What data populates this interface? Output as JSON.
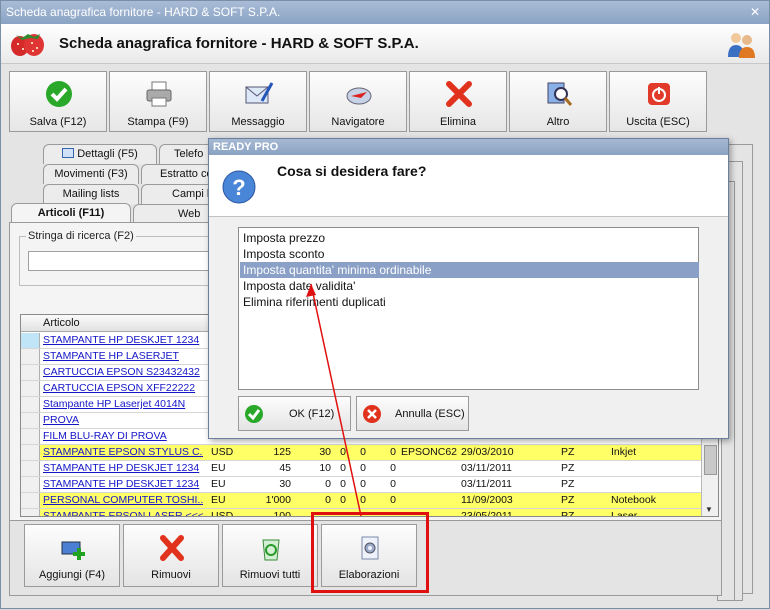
{
  "window": {
    "title": "Scheda anagrafica fornitore - HARD & SOFT S.P.A.",
    "close_glyph": "✕",
    "header_title": "Scheda anagrafica fornitore - HARD & SOFT S.P.A."
  },
  "toolbar": {
    "buttons": [
      {
        "label": "Salva (F12)",
        "icon": "check-icon"
      },
      {
        "label": "Stampa (F9)",
        "icon": "printer-icon"
      },
      {
        "label": "Messaggio",
        "icon": "mail-icon"
      },
      {
        "label": "Navigatore",
        "icon": "compass-icon"
      },
      {
        "label": "Elimina",
        "icon": "delete-icon"
      },
      {
        "label": "Altro",
        "icon": "magnifier-icon"
      },
      {
        "label": "Uscita (ESC)",
        "icon": "power-icon"
      }
    ]
  },
  "tabs": {
    "row1": [
      "Dettagli (F5)",
      "Telefo"
    ],
    "row2": [
      "Movimenti (F3)",
      "Estratto co"
    ],
    "row3": [
      "Mailing lists",
      "Campi li"
    ],
    "row4": [
      "Articoli (F11)",
      "Web"
    ]
  },
  "search": {
    "label": "Stringa di ricerca (F2)",
    "value": ""
  },
  "grid": {
    "header": "Articolo",
    "rows": [
      {
        "articolo": "STAMPANTE HP DESKJET 1234",
        "yellow": false,
        "selected": true,
        "cells": []
      },
      {
        "articolo": "STAMPANTE HP LASERJET",
        "yellow": false,
        "selected": false,
        "cells": []
      },
      {
        "articolo": "CARTUCCIA EPSON S23432432",
        "yellow": false,
        "selected": false,
        "cells": []
      },
      {
        "articolo": "CARTUCCIA EPSON XFF22222",
        "yellow": false,
        "selected": false,
        "cells": []
      },
      {
        "articolo": "Stampante HP Laserjet 4014N",
        "yellow": false,
        "selected": false,
        "cells": []
      },
      {
        "articolo": "PROVA",
        "yellow": false,
        "selected": false,
        "cells": []
      },
      {
        "articolo": "FILM BLU-RAY DI PROVA",
        "yellow": false,
        "selected": false,
        "cells": []
      },
      {
        "articolo": "STAMPANTE EPSON STYLUS C...",
        "yellow": true,
        "selected": false,
        "cells": [
          "USD",
          "125",
          "30",
          "0",
          "0",
          "0",
          "EPSONC62",
          "29/03/2010",
          "PZ",
          "Inkjet"
        ]
      },
      {
        "articolo": "STAMPANTE HP DESKJET 1234",
        "yellow": false,
        "selected": false,
        "cells": [
          "EU",
          "45",
          "10",
          "0",
          "0",
          "0",
          "",
          "03/11/2011",
          "PZ",
          ""
        ]
      },
      {
        "articolo": "STAMPANTE HP DESKJET 1234",
        "yellow": false,
        "selected": false,
        "cells": [
          "EU",
          "30",
          "0",
          "0",
          "0",
          "0",
          "",
          "03/11/2011",
          "PZ",
          ""
        ]
      },
      {
        "articolo": "PERSONAL COMPUTER TOSHI...",
        "yellow": true,
        "selected": false,
        "cells": [
          "EU",
          "1'000",
          "0",
          "0",
          "0",
          "0",
          "",
          "11/09/2003",
          "PZ",
          "Notebook"
        ]
      },
      {
        "articolo": "STAMPANTE EPSON LASER <<<",
        "yellow": true,
        "selected": false,
        "cells": [
          "USD",
          "100",
          "",
          "",
          "",
          "",
          "",
          "23/05/2011",
          "PZ",
          "Laser"
        ]
      }
    ]
  },
  "bottom_buttons": [
    {
      "label": "Aggiungi (F4)",
      "icon": "add-icon"
    },
    {
      "label": "Rimuovi",
      "icon": "remove-icon"
    },
    {
      "label": "Rimuovi tutti",
      "icon": "recycle-bin-icon"
    },
    {
      "label": "Elaborazioni",
      "icon": "gear-document-icon"
    }
  ],
  "dialog": {
    "title": "READY PRO",
    "question": "Cosa si desidera fare?",
    "options": [
      "Imposta prezzo",
      "Imposta sconto",
      "Imposta quantita' minima ordinabile",
      "Imposta date validita'",
      "Elimina riferimenti duplicati"
    ],
    "selected_index": 2,
    "ok_label": "OK (F12)",
    "cancel_label": "Annulla (ESC)"
  },
  "colors": {
    "highlight_box": "#e01010",
    "selected_option": "#8aa0c6",
    "yellow_row": "#ffff66",
    "link_text": "#1515c8"
  }
}
